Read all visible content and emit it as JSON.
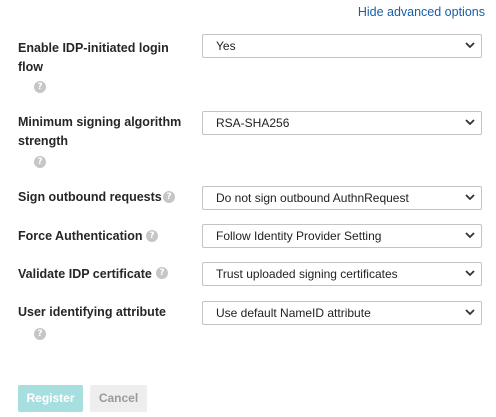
{
  "header": {
    "hide_advanced_label": "Hide advanced options"
  },
  "fields": [
    {
      "label": "Enable IDP-initiated login flow",
      "label_line1": "Enable IDP-initiated login",
      "label_line2": "flow",
      "value": "Yes"
    },
    {
      "label": "Minimum signing algorithm strength",
      "label_line1": "Minimum signing algorithm",
      "label_line2": "strength",
      "value": "RSA-SHA256"
    },
    {
      "label": "Sign outbound requests",
      "value": "Do not sign outbound AuthnRequest"
    },
    {
      "label": "Force Authentication",
      "value": "Follow Identity Provider Setting"
    },
    {
      "label": "Validate IDP certificate",
      "value": "Trust uploaded signing certificates"
    },
    {
      "label": "User identifying attribute",
      "value": "Use default NameID attribute"
    }
  ],
  "help_glyph": "?",
  "actions": {
    "register_label": "Register",
    "cancel_label": "Cancel"
  },
  "colors": {
    "link": "#1a5fa8",
    "register_bg": "#a7dfe0",
    "help_icon": "#c6c6c6"
  }
}
